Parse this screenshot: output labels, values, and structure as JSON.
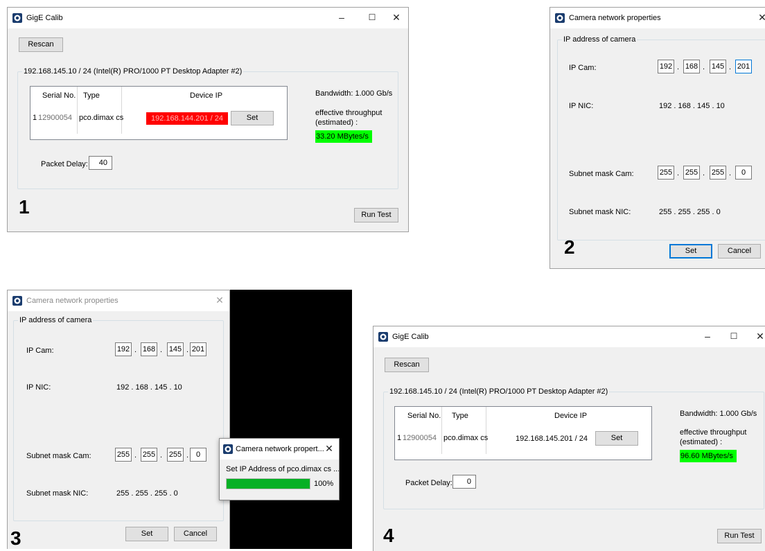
{
  "p1": {
    "number": "1",
    "title": "GigE Calib",
    "rescan": "Rescan",
    "group": "192.168.145.10 / 24 (Intel(R) PRO/1000 PT Desktop Adapter #2)",
    "col_serial": "Serial No.",
    "col_type": "Type",
    "col_ip": "Device IP",
    "row_idx": "1",
    "serial": "12900054",
    "type": "pco.dimax cs",
    "device_ip": "192.168.144.201 / 24",
    "set": "Set",
    "bandwidth": "Bandwidth: 1.000 Gb/s",
    "throughput_1": "effective throughput",
    "throughput_2": "(estimated) :",
    "throughput_value": "33.20 MBytes/s",
    "packet_delay_label": "Packet Delay:",
    "packet_delay": "40",
    "run_test": "Run Test"
  },
  "p2": {
    "number": "2",
    "title": "Camera network properties",
    "group": "IP address of camera",
    "ip_cam_label": "IP Cam:",
    "ip_cam": [
      "192",
      "168",
      "145",
      "201"
    ],
    "ip_nic_label": "IP NIC:",
    "ip_nic": "192  .  168  .  145  .  10",
    "mask_cam_label": "Subnet mask Cam:",
    "mask_cam": [
      "255",
      "255",
      "255",
      "0"
    ],
    "mask_nic_label": "Subnet mask NIC:",
    "mask_nic": "255  .  255  .  255  .  0",
    "set": "Set",
    "cancel": "Cancel"
  },
  "p3": {
    "number": "3",
    "title": "Camera network properties",
    "group": "IP address of camera",
    "ip_cam_label": "IP Cam:",
    "ip_cam": [
      "192",
      "168",
      "145",
      "201"
    ],
    "ip_nic_label": "IP NIC:",
    "ip_nic": "192  .  168  .  145  .  10",
    "mask_cam_label": "Subnet mask Cam:",
    "mask_cam": [
      "255",
      "255",
      "255",
      "0"
    ],
    "mask_nic_label": "Subnet mask NIC:",
    "mask_nic": "255  .  255  .  255  .  0",
    "set": "Set",
    "cancel": "Cancel",
    "popup_title": "Camera network propert...",
    "popup_msg": "Set IP Address of pco.dimax cs ...",
    "progress_text": "100%",
    "progress": 1.0
  },
  "p4": {
    "number": "4",
    "title": "GigE Calib",
    "rescan": "Rescan",
    "group": "192.168.145.10 / 24 (Intel(R) PRO/1000 PT Desktop Adapter #2)",
    "col_serial": "Serial No.",
    "col_type": "Type",
    "col_ip": "Device IP",
    "row_idx": "1",
    "serial": "12900054",
    "type": "pco.dimax cs",
    "device_ip": "192.168.145.201 / 24",
    "set": "Set",
    "bandwidth": "Bandwidth: 1.000 Gb/s",
    "throughput_1": "effective throughput",
    "throughput_2": "(estimated) :",
    "throughput_value": "96.60 MBytes/s",
    "packet_delay_label": "Packet Delay:",
    "packet_delay": "0",
    "run_test": "Run Test"
  },
  "colors": {
    "error_red": "#ff0000",
    "ok_green": "#00ff00",
    "progress_green": "#06b025",
    "focus_blue": "#0078d7"
  },
  "icons": {
    "window_icon": "camera-app-icon",
    "minimize": "minimize-icon",
    "maximize": "maximize-icon",
    "close": "close-icon"
  }
}
